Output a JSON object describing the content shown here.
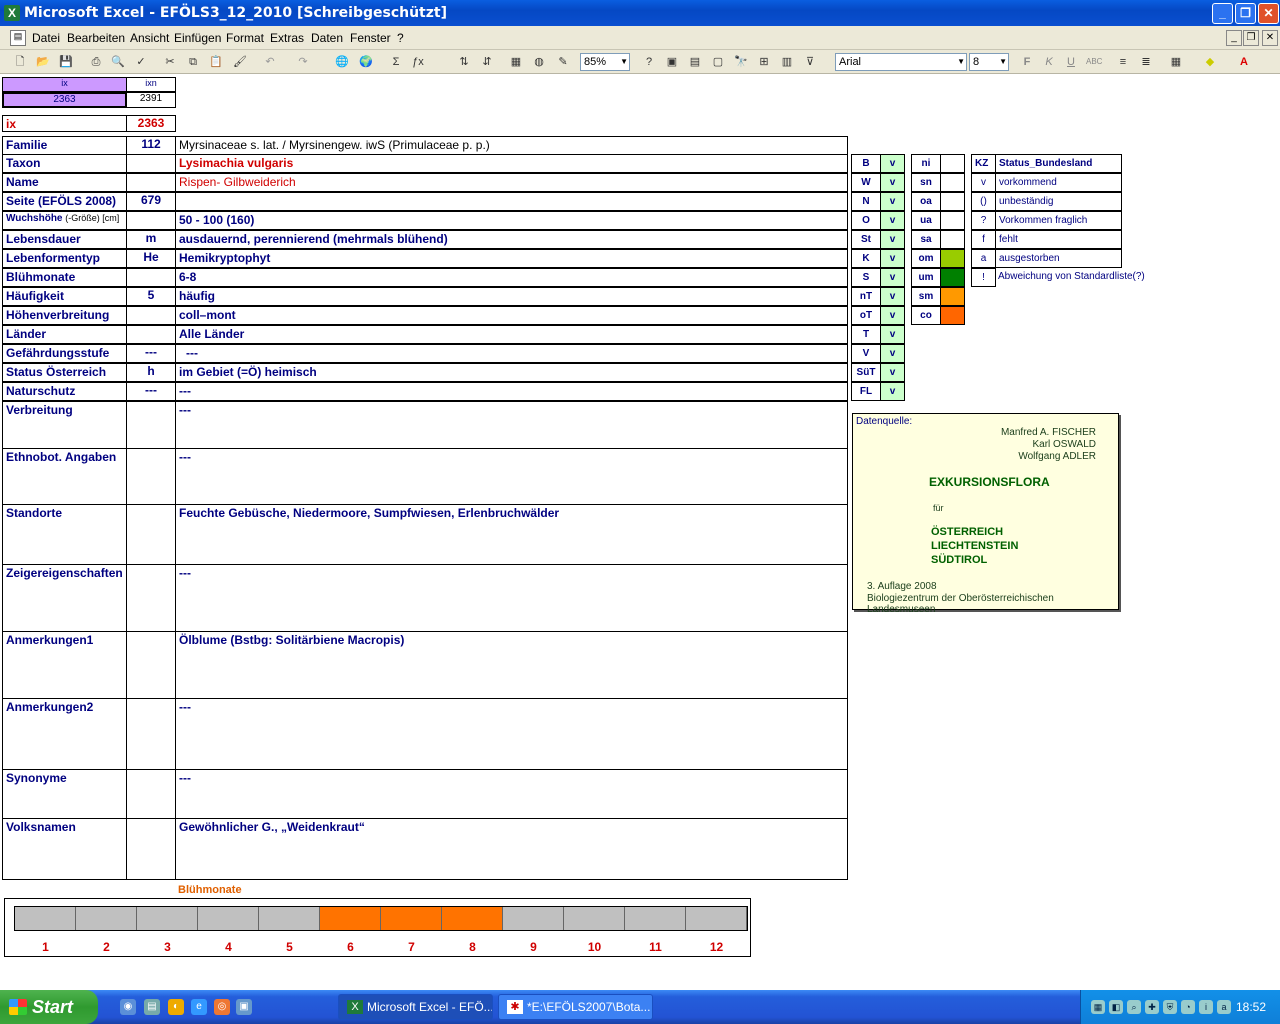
{
  "window": {
    "title": "Microsoft Excel - EFÖLS3_12_2010  [Schreibgeschützt]",
    "app_icon": "X"
  },
  "menu": [
    "Datei",
    "Bearbeiten",
    "Ansicht",
    "Einfügen",
    "Format",
    "Extras",
    "Daten",
    "Fenster",
    "?"
  ],
  "toolbar": {
    "zoom": "85%",
    "font": "Arial",
    "size": "8"
  },
  "head": {
    "ix_label": "ix",
    "ixn_label": "ixn",
    "ix_val": "2363",
    "ixn_val": "2391",
    "ix2_label": "ix",
    "ix2_val": "2363"
  },
  "rows": {
    "familie": {
      "label": "Familie",
      "num": "112",
      "val": "Myrsinaceae s. lat.  /  Myrsinengew. iwS (Primulaceae p. p.)"
    },
    "taxon": {
      "label": "Taxon",
      "val": "Lysimachia vulgaris"
    },
    "name": {
      "label": "Name",
      "val": "Rispen- Gilbweiderich"
    },
    "seite": {
      "label": "Seite (EFÖLS 2008)",
      "num": "679"
    },
    "wuchs": {
      "label": "Wuchshöhe",
      "label_small": "(-Größe) [cm]",
      "val": "50 - 100 (160)"
    },
    "lebensdauer": {
      "label": "Lebensdauer",
      "num": "m",
      "val": "ausdauernd, perennierend (mehrmals blühend)"
    },
    "lebensform": {
      "label": "Lebenformentyp",
      "num": "He",
      "val": "Hemikryptophyt"
    },
    "bluehmonate": {
      "label": "Blühmonate",
      "val": "6-8"
    },
    "haeufigkeit": {
      "label": "Häufigkeit",
      "num": "5",
      "val": "häufig"
    },
    "hoehen": {
      "label": "Höhenverbreitung",
      "val": "coll–mont"
    },
    "laender": {
      "label": "Länder",
      "val": "Alle Länder"
    },
    "gefaehrdung": {
      "label": "Gefährdungsstufe",
      "num": "---",
      "val": "---"
    },
    "status": {
      "label": "Status Österreich",
      "num": "h",
      "val": "im Gebiet (=Ö) heimisch"
    },
    "naturschutz": {
      "label": "Naturschutz",
      "num": "---",
      "val": "---"
    },
    "verbreitung": {
      "label": "Verbreitung",
      "val": "---"
    },
    "ethnobot": {
      "label": "Ethnobot. Angaben",
      "val": "---"
    },
    "standorte": {
      "label": "Standorte",
      "val": "Feuchte Gebüsche, Niedermoore, Sumpfwiesen, Erlenbruchwälder"
    },
    "zeiger": {
      "label": "Zeigereigenschaften",
      "val": "---"
    },
    "anm1": {
      "label": "Anmerkungen1",
      "val": "Ölblume (Bstbg: Solitärbiene Macropis)"
    },
    "anm2": {
      "label": "Anmerkungen2",
      "val": "---"
    },
    "synonyme": {
      "label": "Synonyme",
      "val": "---"
    },
    "volksnamen": {
      "label": "Volksnamen",
      "val": "Gewöhnlicher G., „Weidenkraut“"
    }
  },
  "states": [
    {
      "k": "B",
      "v": "v"
    },
    {
      "k": "W",
      "v": "v"
    },
    {
      "k": "N",
      "v": "v"
    },
    {
      "k": "O",
      "v": "v"
    },
    {
      "k": "St",
      "v": "v"
    },
    {
      "k": "K",
      "v": "v"
    },
    {
      "k": "S",
      "v": "v"
    },
    {
      "k": "nT",
      "v": "v"
    },
    {
      "k": "oT",
      "v": "v"
    },
    {
      "k": "T",
      "v": "v"
    },
    {
      "k": "V",
      "v": "v"
    },
    {
      "k": "SüT",
      "v": "v"
    },
    {
      "k": "FL",
      "v": "v"
    }
  ],
  "zones": [
    {
      "k": "ni",
      "color": "#ffffff"
    },
    {
      "k": "sn",
      "color": "#ffffff"
    },
    {
      "k": "oa",
      "color": "#ffffff"
    },
    {
      "k": "ua",
      "color": "#ffffff"
    },
    {
      "k": "sa",
      "color": "#ffffff"
    },
    {
      "k": "om",
      "color": "#99cc00"
    },
    {
      "k": "um",
      "color": "#008000"
    },
    {
      "k": "sm",
      "color": "#ff9900"
    },
    {
      "k": "co",
      "color": "#ff6600"
    }
  ],
  "legend_head": {
    "kz": "KZ",
    "title": "Status_Bundesland"
  },
  "legend": [
    {
      "k": "v",
      "t": "vorkommend"
    },
    {
      "k": "()",
      "t": "unbeständig"
    },
    {
      "k": "?",
      "t": "Vorkommen fraglich"
    },
    {
      "k": "f",
      "t": "fehlt"
    },
    {
      "k": "a",
      "t": "ausgestorben"
    },
    {
      "k": "!",
      "t": "Abweichung von Standardliste(?)"
    }
  ],
  "source": {
    "label": "Datenquelle:",
    "author1": "Manfred A. FISCHER",
    "author2": "Karl OSWALD",
    "author3": "Wolfgang ADLER",
    "title": "EXKURSIONSFLORA",
    "fuer": "für",
    "c1": "ÖSTERREICH",
    "c2": "LIECHTENSTEIN",
    "c3": "SÜDTIROL",
    "edition": "3. Auflage 2008",
    "publisher": "Biologiezentrum der Oberösterreichischen Landesmuseen"
  },
  "months": {
    "title": "Blühmonate",
    "labels": [
      "1",
      "2",
      "3",
      "4",
      "5",
      "6",
      "7",
      "8",
      "9",
      "10",
      "11",
      "12"
    ],
    "active": [
      6,
      7,
      8
    ],
    "active_color": "#ff7300"
  },
  "taskbar": {
    "start": "Start",
    "task1": "Microsoft Excel - EFÖ...",
    "task2": "*E:\\EFÖLS2007\\Bota...",
    "clock": "18:52"
  }
}
